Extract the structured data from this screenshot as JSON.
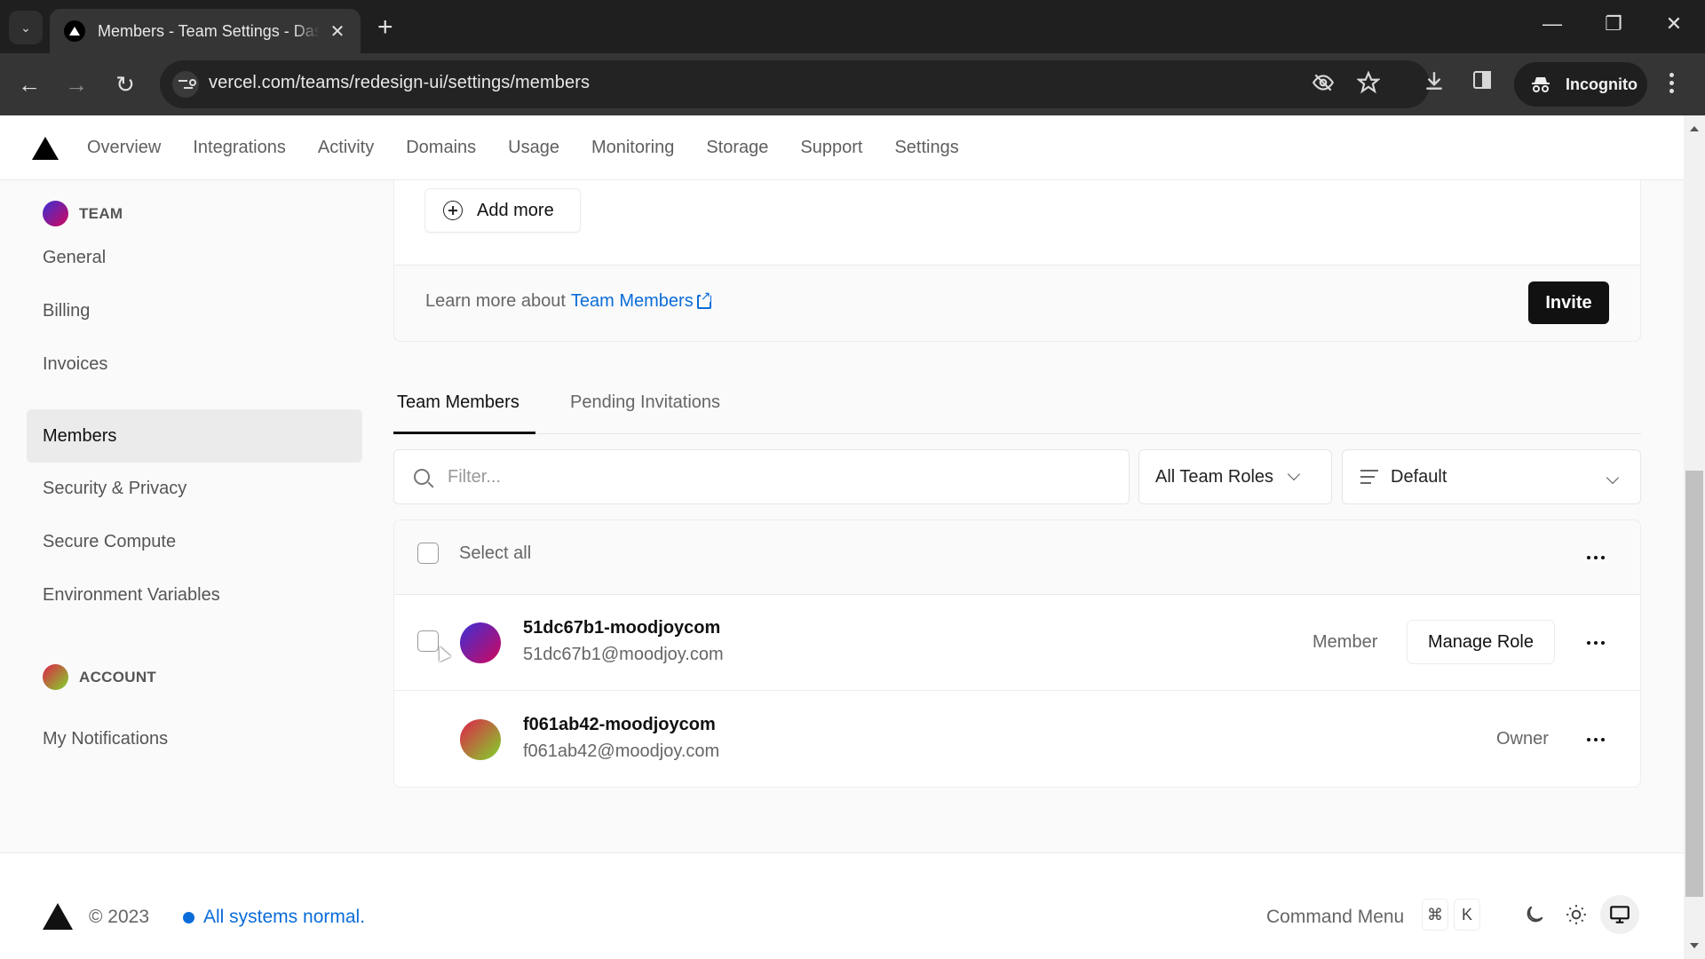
{
  "browser": {
    "tab_title": "Members - Team Settings - Dashboard",
    "url": "vercel.com/teams/redesign-ui/settings/members",
    "profile_label": "Incognito"
  },
  "topnav": {
    "items": [
      "Overview",
      "Integrations",
      "Activity",
      "Domains",
      "Usage",
      "Monitoring",
      "Storage",
      "Support",
      "Settings"
    ]
  },
  "sidebar": {
    "team_heading": "TEAM",
    "team_items": [
      "General",
      "Billing",
      "Invoices",
      "Members",
      "Security & Privacy",
      "Secure Compute",
      "Environment Variables"
    ],
    "active_item": "Members",
    "account_heading": "ACCOUNT",
    "account_items": [
      "My Notifications"
    ]
  },
  "invite_card": {
    "add_more_label": "Add more",
    "learn_prefix": "Learn more about",
    "learn_link": "Team Members",
    "invite_label": "Invite"
  },
  "tabs": {
    "items": [
      "Team Members",
      "Pending Invitations"
    ],
    "active": "Team Members"
  },
  "filters": {
    "search_placeholder": "Filter...",
    "search_value": "",
    "role_select": "All Team Roles",
    "sort_select": "Default"
  },
  "list": {
    "select_all_label": "Select all",
    "members": [
      {
        "username": "51dc67b1-moodjoycom",
        "email": "51dc67b1@moodjoy.com",
        "role": "Member",
        "manage_label": "Manage Role",
        "selectable": true,
        "avatar_gradient": [
          "#3b2fd6",
          "#d1085c"
        ]
      },
      {
        "username": "f061ab42-moodjoycom",
        "email": "f061ab42@moodjoy.com",
        "role": "Owner",
        "manage_label": "",
        "selectable": false,
        "avatar_gradient": [
          "#e0204a",
          "#7fd62a"
        ]
      }
    ]
  },
  "footer": {
    "copyright": "© 2023",
    "status": "All systems normal.",
    "command_menu": "Command Menu",
    "shortcut_keys": [
      "⌘",
      "K"
    ],
    "theme_active": "system"
  },
  "colors": {
    "link": "#0a6cd9",
    "primary_button": "#111111",
    "team_avatar": [
      "#3b2fd6",
      "#d1085c"
    ],
    "account_avatar": [
      "#e0204a",
      "#7fd62a"
    ]
  }
}
